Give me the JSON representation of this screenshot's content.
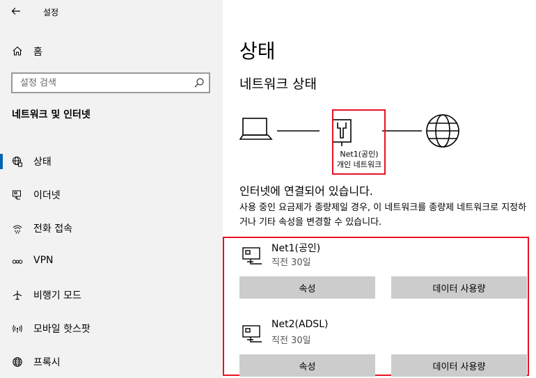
{
  "window": {
    "title": "설정",
    "back_icon": "arrow-left-icon"
  },
  "sidebar": {
    "home_label": "홈",
    "search": {
      "placeholder": "설정 검색"
    },
    "section_title": "네트워크 및 인터넷",
    "items": [
      {
        "label": "상태",
        "icon": "globe-status-icon",
        "selected": true
      },
      {
        "label": "이더넷",
        "icon": "ethernet-icon"
      },
      {
        "label": "전화 접속",
        "icon": "dialup-icon"
      },
      {
        "label": "VPN",
        "icon": "vpn-icon"
      },
      {
        "label": "비행기 모드",
        "icon": "airplane-icon"
      },
      {
        "label": "모바일 핫스팟",
        "icon": "hotspot-icon"
      },
      {
        "label": "프록시",
        "icon": "globe-icon"
      }
    ]
  },
  "main": {
    "title": "상태",
    "subtitle": "네트워크 상태",
    "diagram": {
      "network_name": "Net1(공인)",
      "network_type": "개인 네트워크"
    },
    "connection_status": "인터넷에 연결되어 있습니다.",
    "description": "사용 중인 요금제가 종량제일 경우, 이 네트워크를 종량제 네트워크로 지정하거나 기타 속성을 변경할 수 있습니다.",
    "networks": [
      {
        "name": "Net1(공인)",
        "time": "직전 30일",
        "properties_label": "속성",
        "usage_label": "데이터 사용량"
      },
      {
        "name": "Net2(ADSL)",
        "time": "직전 30일",
        "properties_label": "속성",
        "usage_label": "데이터 사용량"
      }
    ]
  },
  "colors": {
    "sidebar_bg": "#f2f2f2",
    "accent": "#0063b1",
    "highlight": "#e81123",
    "button_bg": "#cccccc"
  }
}
